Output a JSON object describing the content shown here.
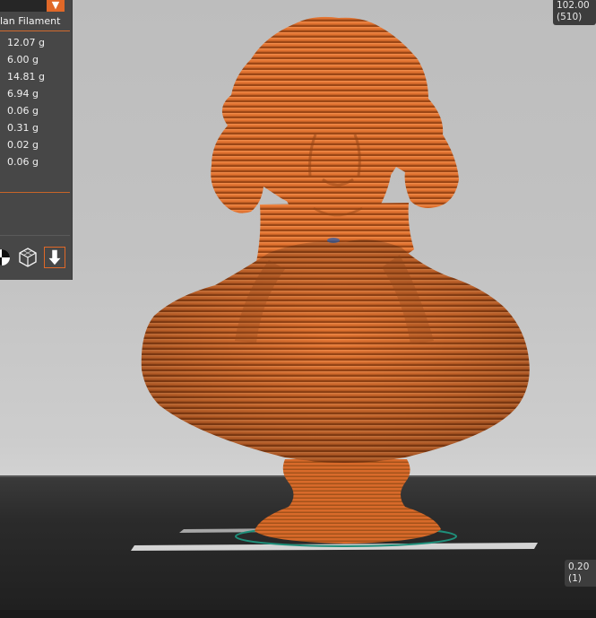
{
  "side_panel": {
    "heading": "lan Filament",
    "materials": [
      "12.07 g",
      "6.00 g",
      "14.81 g",
      "6.94 g",
      "0.06 g",
      "0.31 g",
      "0.02 g",
      "0.06 g"
    ],
    "dropdown_arrow": "▼"
  },
  "layer_slider": {
    "top_height": "102.00",
    "top_layer": "(510)",
    "bottom_height": "0.20",
    "bottom_layer": "(1)"
  },
  "icons": [
    "color-wheel-icon",
    "wireframe-cube-icon",
    "export-arrow-icon"
  ],
  "colors": {
    "model": "#e07230",
    "accent": "#e06828",
    "panel": "#474747"
  }
}
